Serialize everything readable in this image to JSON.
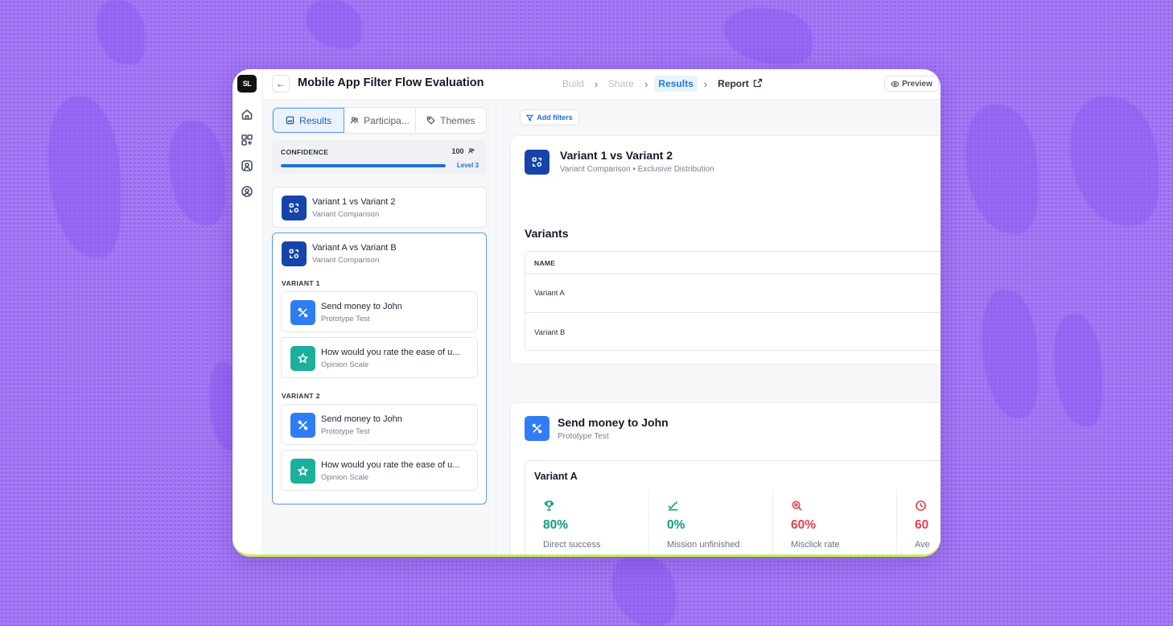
{
  "app": {
    "logo_text": "SL",
    "title": "Mobile App Filter Flow Evaluation",
    "steps": [
      {
        "label": "Build"
      },
      {
        "label": "Share"
      },
      {
        "label": "Results"
      },
      {
        "label": "Report"
      }
    ],
    "preview_label": "Preview"
  },
  "rail": {
    "icons": [
      "home-icon",
      "apps-icon",
      "users-icon",
      "user-circle-icon"
    ]
  },
  "left": {
    "tabs": [
      {
        "label": "Results",
        "icon": "image-icon"
      },
      {
        "label": "Participa...",
        "icon": "users-icon"
      },
      {
        "label": "Themes",
        "icon": "tag-icon"
      }
    ],
    "confidence": {
      "label": "CONFIDENCE",
      "count": "100",
      "level": "Level 3",
      "progress": 1.0
    },
    "comparisons": [
      {
        "title": "Variant 1 vs Variant 2",
        "subtitle": "Variant Comparison"
      },
      {
        "title": "Variant A vs Variant B",
        "subtitle": "Variant Comparison"
      }
    ],
    "variant1": {
      "label": "VARIANT 1",
      "items": [
        {
          "title": "Send money to John",
          "subtitle": "Prototype Test"
        },
        {
          "title": "How would you rate the ease of u...",
          "subtitle": "Opinion Scale"
        }
      ]
    },
    "variant2": {
      "label": "VARIANT 2",
      "items": [
        {
          "title": "Send money to John",
          "subtitle": "Prototype Test"
        },
        {
          "title": "How would you rate the ease of u...",
          "subtitle": "Opinion Scale"
        }
      ]
    }
  },
  "main": {
    "add_filters": "Add filters",
    "comparison": {
      "title": "Variant 1 vs Variant 2",
      "subtitle": "Variant Comparison • Exclusive Distribution"
    },
    "variants": {
      "heading": "Variants",
      "column": "NAME",
      "rows": [
        "Variant A",
        "Variant B"
      ]
    },
    "task": {
      "title": "Send money to John",
      "subtitle": "Prototype Test",
      "variant": "Variant A",
      "metrics": [
        {
          "value": "80%",
          "label": "Direct success",
          "icon": "trophy-icon",
          "color": "#0f9b80"
        },
        {
          "value": "0%",
          "label": "Mission unfinished",
          "icon": "check-flag-icon",
          "color": "#0f9b80"
        },
        {
          "value": "60%",
          "label": "Misclick rate",
          "icon": "target-icon",
          "color": "#e53f4f"
        },
        {
          "value": "60",
          "label": "Ave",
          "icon": "clock-icon",
          "color": "#e53f4f"
        }
      ]
    }
  }
}
